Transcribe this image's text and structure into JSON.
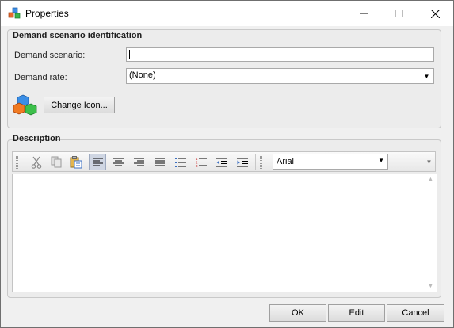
{
  "window": {
    "title": "Properties"
  },
  "title_buttons": {
    "minimize_icon": "minimize-icon",
    "maximize_icon": "maximize-icon",
    "close_icon": "close-icon"
  },
  "identification": {
    "group_title": "Demand scenario identification",
    "scenario_label": "Demand scenario:",
    "scenario_value": "",
    "rate_label": "Demand rate:",
    "rate_value": "(None)",
    "change_icon_label": "Change Icon..."
  },
  "description": {
    "group_title": "Description",
    "toolbar": {
      "buttons": [
        "cut-icon",
        "copy-icon",
        "paste-icon",
        "align-left-icon",
        "align-center-icon",
        "align-right-icon",
        "justify-icon",
        "bullet-list-icon",
        "numbered-list-icon",
        "outdent-icon",
        "indent-icon"
      ],
      "active": "align-left-icon",
      "font_value": "Arial"
    },
    "text": ""
  },
  "footer": {
    "ok_label": "OK",
    "edit_label": "Edit",
    "cancel_label": "Cancel"
  }
}
